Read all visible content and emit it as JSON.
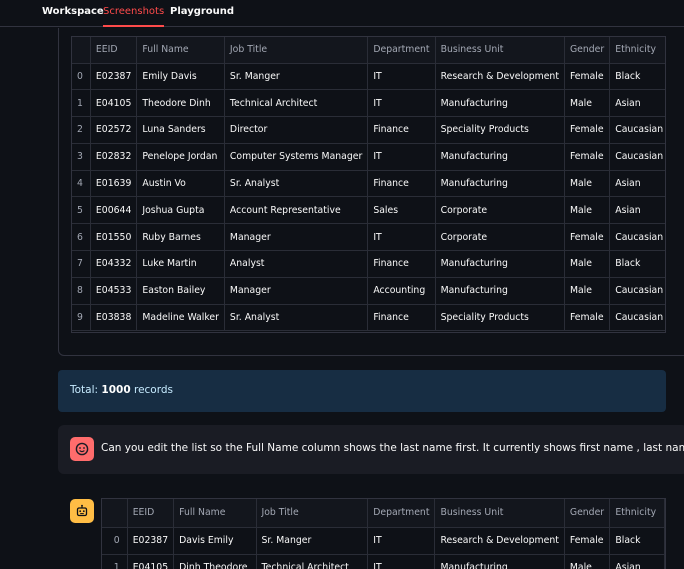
{
  "tabs": [
    {
      "label": "Workspace",
      "active": false
    },
    {
      "label": "Screenshots",
      "active": true
    },
    {
      "label": "Playground",
      "active": false
    }
  ],
  "table1": {
    "columns": [
      "",
      "EEID",
      "Full Name",
      "Job Title",
      "Department",
      "Business Unit",
      "Gender",
      "Ethnicity"
    ],
    "rows": [
      [
        "0",
        "E02387",
        "Emily Davis",
        "Sr. Manger",
        "IT",
        "Research & Development",
        "Female",
        "Black"
      ],
      [
        "1",
        "E04105",
        "Theodore Dinh",
        "Technical Architect",
        "IT",
        "Manufacturing",
        "Male",
        "Asian"
      ],
      [
        "2",
        "E02572",
        "Luna Sanders",
        "Director",
        "Finance",
        "Speciality Products",
        "Female",
        "Caucasian"
      ],
      [
        "3",
        "E02832",
        "Penelope Jordan",
        "Computer Systems Manager",
        "IT",
        "Manufacturing",
        "Female",
        "Caucasian"
      ],
      [
        "4",
        "E01639",
        "Austin Vo",
        "Sr. Analyst",
        "Finance",
        "Manufacturing",
        "Male",
        "Asian"
      ],
      [
        "5",
        "E00644",
        "Joshua Gupta",
        "Account Representative",
        "Sales",
        "Corporate",
        "Male",
        "Asian"
      ],
      [
        "6",
        "E01550",
        "Ruby Barnes",
        "Manager",
        "IT",
        "Corporate",
        "Female",
        "Caucasian"
      ],
      [
        "7",
        "E04332",
        "Luke Martin",
        "Analyst",
        "Finance",
        "Manufacturing",
        "Male",
        "Black"
      ],
      [
        "8",
        "E04533",
        "Easton Bailey",
        "Manager",
        "Accounting",
        "Manufacturing",
        "Male",
        "Caucasian"
      ],
      [
        "9",
        "E03838",
        "Madeline Walker",
        "Sr. Analyst",
        "Finance",
        "Speciality Products",
        "Female",
        "Caucasian"
      ]
    ]
  },
  "total": {
    "prefix": "Total:",
    "count": "1000",
    "suffix": "records"
  },
  "user_message": "Can you edit the list so the Full Name column shows the last name first. It currently shows first name , last name",
  "table2": {
    "columns": [
      "",
      "EEID",
      "Full Name",
      "Job Title",
      "Department",
      "Business Unit",
      "Gender",
      "Ethnicity"
    ],
    "rows": [
      [
        "0",
        "E02387",
        "Davis Emily",
        "Sr. Manger",
        "IT",
        "Research & Development",
        "Female",
        "Black"
      ],
      [
        "1",
        "E04105",
        "Dinh Theodore",
        "Technical Architect",
        "IT",
        "Manufacturing",
        "Male",
        "Asian"
      ]
    ]
  },
  "colors": {
    "accent": "#ff4b4b",
    "info_bg": "#172d43",
    "user_avatar": "#ff6c6c",
    "bot_avatar": "#ffbd45"
  },
  "icons": {
    "user_avatar": "face-smile-icon",
    "bot_avatar": "robot-icon"
  }
}
